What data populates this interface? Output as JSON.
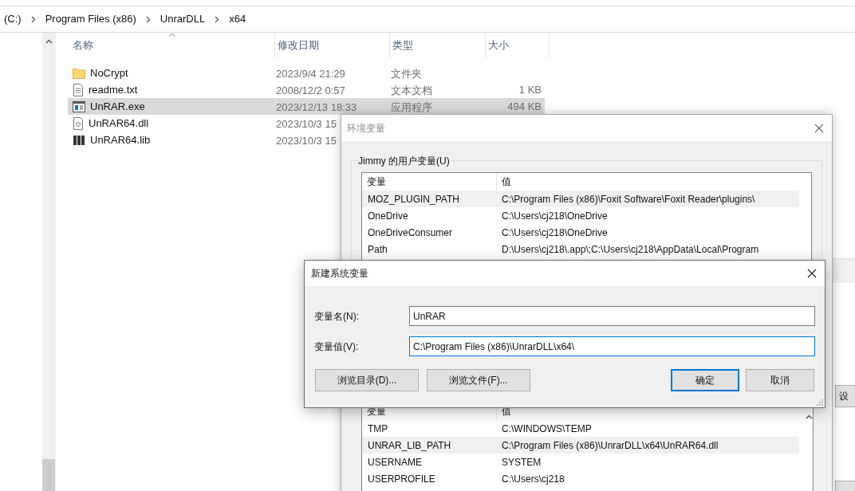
{
  "explorer": {
    "breadcrumb": [
      "(C:)",
      "Program Files (x86)",
      "UnrarDLL",
      "x64"
    ],
    "columns": [
      {
        "label": "名称",
        "sorted": true
      },
      {
        "label": "修改日期",
        "sorted": false
      },
      {
        "label": "类型",
        "sorted": false
      },
      {
        "label": "大小",
        "sorted": false
      }
    ],
    "files": [
      {
        "name": "NoCrypt",
        "kind": "folder",
        "date": "2023/9/4 21:29",
        "type": "文件夹",
        "selected": false
      },
      {
        "name": "readme.txt",
        "kind": "text",
        "date": "2008/12/2 0:57",
        "type": "文本文档",
        "size": "1 KB",
        "selected": false
      },
      {
        "name": "UnRAR.exe",
        "kind": "exe",
        "date": "2023/12/13 18:33",
        "type": "应用程序",
        "size": "494 KB",
        "selected": true
      },
      {
        "name": "UnRAR64.dll",
        "kind": "dll",
        "date": "2023/10/3 15",
        "selected": false
      },
      {
        "name": "UnRAR64.lib",
        "kind": "lib",
        "date": "2023/10/3 15",
        "selected": false
      }
    ]
  },
  "env_dialog": {
    "title": "环境变量",
    "active": false,
    "user_group": "Jimmy 的用户变量(U)",
    "user_columns": [
      "变量",
      "值"
    ],
    "user_vars": [
      {
        "name": "MOZ_PLUGIN_PATH",
        "value": "C:\\Program Files (x86)\\Foxit Software\\Foxit Reader\\plugins\\",
        "selected": true
      },
      {
        "name": "OneDrive",
        "value": "C:\\Users\\cj218\\OneDrive",
        "selected": false
      },
      {
        "name": "OneDriveConsumer",
        "value": "C:\\Users\\cj218\\OneDrive",
        "selected": false
      },
      {
        "name": "Path",
        "value": "D:\\Users\\cj218\\.app\\;C:\\Users\\cj218\\AppData\\Local\\Program",
        "selected": false
      }
    ],
    "system_columns": [
      "变量",
      "值"
    ],
    "system_vars": [
      {
        "name": "TMP",
        "value": "C:\\WINDOWS\\TEMP",
        "selected": false
      },
      {
        "name": "UNRAR_LIB_PATH",
        "value": "C:\\Program Files (x86)\\UnrarDLL\\x64\\UnRAR64.dll",
        "selected": true
      },
      {
        "name": "USERNAME",
        "value": "SYSTEM",
        "selected": false
      },
      {
        "name": "USERPROFILE",
        "value": "C:\\Users\\cj218",
        "selected": false
      }
    ]
  },
  "new_dialog": {
    "title": "新建系统变量",
    "active": true,
    "fields": [
      {
        "label": "变量名(N):",
        "value": "UnRAR",
        "focused": false
      },
      {
        "label": "变量值(V):",
        "value": "C:\\Program Files (x86)\\UnrarDLL\\x64\\",
        "focused": true
      }
    ],
    "browse_buttons": [
      {
        "label": "浏览目录(D)...",
        "default": false
      },
      {
        "label": "浏览文件(F)...",
        "default": false
      }
    ],
    "action_buttons": [
      {
        "label": "确定",
        "default": true
      },
      {
        "label": "取消",
        "default": false
      }
    ]
  },
  "background_window": {
    "button": "设"
  }
}
